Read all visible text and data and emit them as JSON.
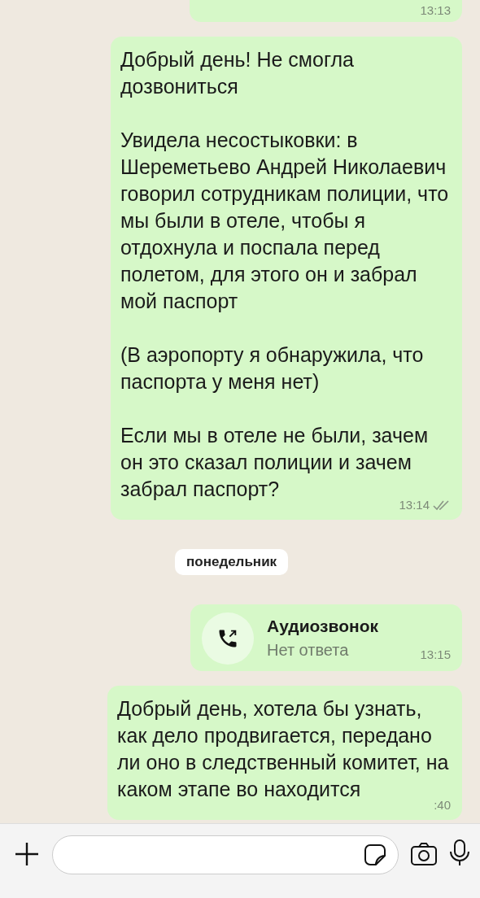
{
  "messages": [
    {
      "kind": "cut",
      "time": "13:13"
    },
    {
      "kind": "text",
      "paragraphs": [
        "Добрый день! Не смогла дозвониться",
        "Увидела несостыковки: в Шереметьево Андрей Николаевич говорил сотрудникам полиции, что мы были в отеле, чтобы я отдохнула и поспала перед полетом, для этого он и забрал мой паспорт",
        "(В аэропорту я обнаружила, что паспорта у меня нет)",
        "Если мы в отеле не были, зачем он это сказал полиции и зачем забрал паспорт?"
      ],
      "time": "13:14",
      "read": false
    },
    {
      "kind": "date",
      "label": "понедельник"
    },
    {
      "kind": "call",
      "title": "Аудиозвонок",
      "subtitle": "Нет ответа",
      "time": "13:15"
    },
    {
      "kind": "text",
      "paragraphs": [
        "Добрый день, хотела бы узнать, как дело продвигается, передано ли оно в следственный комитет, на каком этапе во находится"
      ],
      "time": ":40"
    }
  ]
}
